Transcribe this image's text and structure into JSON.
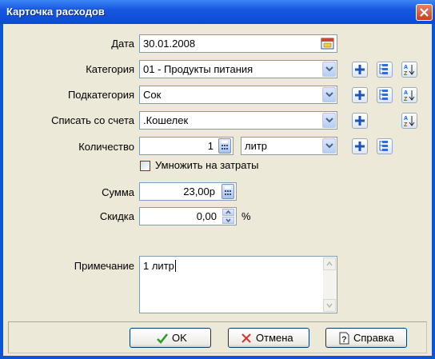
{
  "window": {
    "title": "Карточка расходов"
  },
  "form": {
    "date": {
      "label": "Дата",
      "value": "30.01.2008"
    },
    "category": {
      "label": "Категория",
      "value": "01 - Продукты питания"
    },
    "subcategory": {
      "label": "Подкатегория",
      "value": "Сок"
    },
    "account": {
      "label": "Списать со счета",
      "value": ".Кошелек"
    },
    "quantity": {
      "label": "Количество",
      "value": "1",
      "unit": "литр"
    },
    "multiply": {
      "label": "Умножить на затраты",
      "checked": false
    },
    "sum": {
      "label": "Сумма",
      "value": "23,00р"
    },
    "discount": {
      "label": "Скидка",
      "value": "0,00",
      "unit": "%"
    },
    "note": {
      "label": "Примечание",
      "value": "1 литр"
    }
  },
  "buttons": {
    "ok": "OK",
    "cancel": "Отмена",
    "help": "Справка"
  },
  "colors": {
    "title_bar": "#0c49d6",
    "client": "#ece9d8",
    "field_border": "#7f9db9",
    "accent_blue": "#1b53c5"
  }
}
